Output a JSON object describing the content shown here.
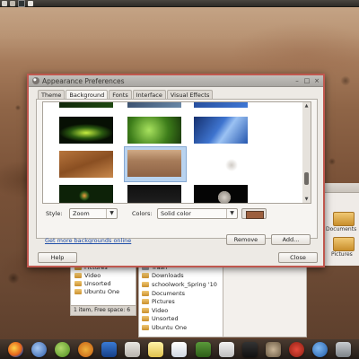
{
  "dialog": {
    "title": "Appearance Preferences",
    "tabs": [
      "Theme",
      "Background",
      "Fonts",
      "Interface",
      "Visual Effects"
    ],
    "active_tab": "Background",
    "selected_thumbnail": 4,
    "style_label": "Style:",
    "style_value": "Zoom",
    "colors_label": "Colors:",
    "colors_value": "Solid color",
    "color_swatch": "#9c5f3e",
    "more_link": "Get more backgrounds online",
    "remove_button": "Remove",
    "add_button": "Add...",
    "help_button": "Help",
    "close_button": "Close"
  },
  "file_manager_left": {
    "items": [
      "Pictures",
      "Video",
      "Unsorted",
      "Ubuntu One"
    ],
    "status": "1 item, Free space: 6"
  },
  "file_manager_middle": {
    "items": [
      "Trash",
      "Downloads",
      "schoolwork_Spring '10",
      "Documents",
      "Pictures",
      "Video",
      "Unsorted",
      "Ubuntu One"
    ]
  },
  "file_manager_right": {
    "items": [
      "Documents",
      "Pictures"
    ]
  },
  "colors": {
    "dialog_border": "#c0574e",
    "link": "#1f4ea8",
    "selection": "#b9d3ef"
  }
}
